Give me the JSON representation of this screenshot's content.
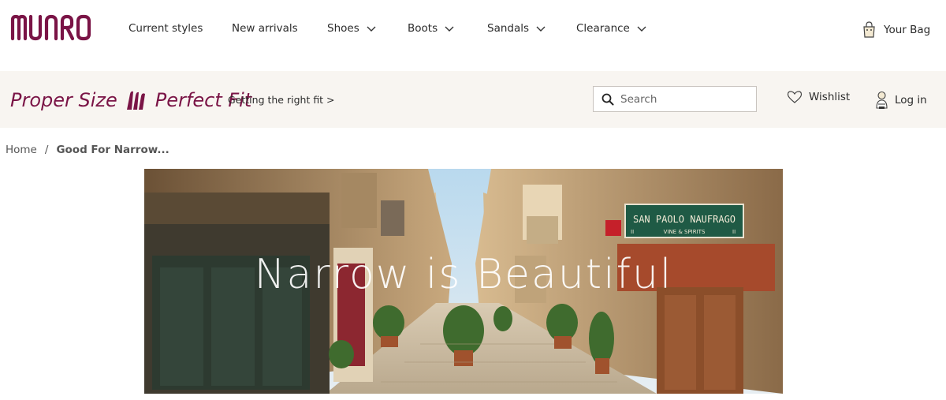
{
  "brand": {
    "logo_text": "MUNRO",
    "brand_color": "#7a1446"
  },
  "nav": {
    "items": [
      {
        "label": "Current styles",
        "has_dropdown": false
      },
      {
        "label": "New arrivals",
        "has_dropdown": false
      },
      {
        "label": "Shoes",
        "has_dropdown": true
      },
      {
        "label": "Boots",
        "has_dropdown": true
      },
      {
        "label": "Sandals",
        "has_dropdown": true
      },
      {
        "label": "Clearance",
        "has_dropdown": true
      }
    ],
    "bag_label": "Your Bag",
    "bag_icon": "shopping-bag-icon"
  },
  "promo": {
    "left_text": "Proper Size",
    "right_text": "Perfect Fit",
    "fit_link": "Getting the right fit >",
    "band_color": "#f8f5f1"
  },
  "search": {
    "placeholder": "Search",
    "value": ""
  },
  "account": {
    "wishlist_label": "Wishlist",
    "wishlist_icon": "heart-icon",
    "login_label": "Log in",
    "login_icon": "user-icon"
  },
  "breadcrumb": {
    "home": "Home",
    "separator": "/",
    "current": "Good For Narrow..."
  },
  "hero": {
    "title": "Narrow is Beautiful",
    "sign_text": "SAN PAOLO NAUFRAGO",
    "sign_subtext": "VINE & SPIRITS",
    "sign_left": "II",
    "sign_right": "II"
  }
}
